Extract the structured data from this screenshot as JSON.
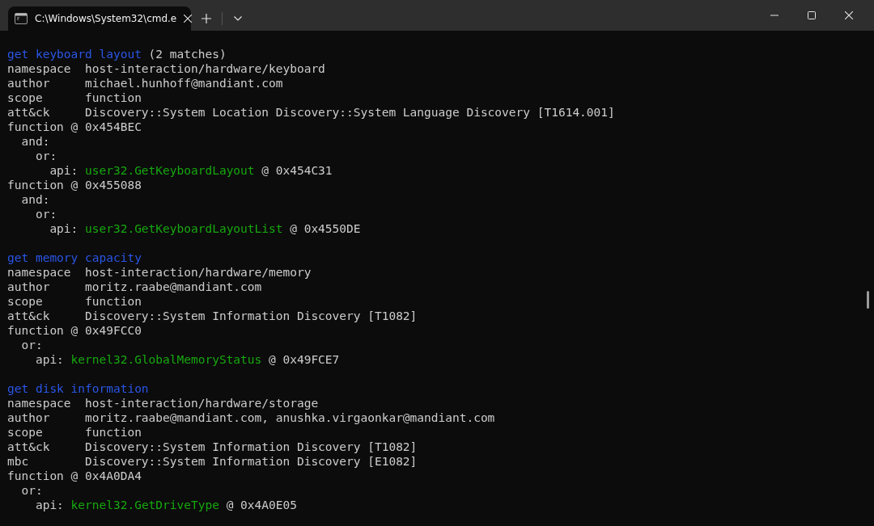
{
  "tabs": [
    {
      "title": "C:\\Windows\\System32\\cmd.e",
      "selected": true
    }
  ],
  "terminal": {
    "sections": [
      {
        "lines": [
          {
            "segments": [
              {
                "kind": "rule",
                "text": "get keyboard layout"
              },
              {
                "kind": "text",
                "text": " (2 matches)"
              }
            ]
          },
          {
            "segments": [
              {
                "kind": "text",
                "text": "namespace  host-interaction/hardware/keyboard"
              }
            ]
          },
          {
            "segments": [
              {
                "kind": "text",
                "text": "author     michael.hunhoff@mandiant.com"
              }
            ]
          },
          {
            "segments": [
              {
                "kind": "text",
                "text": "scope      function"
              }
            ]
          },
          {
            "segments": [
              {
                "kind": "text",
                "text": "att&ck     Discovery::System Location Discovery::System Language Discovery [T1614.001]"
              }
            ]
          },
          {
            "segments": [
              {
                "kind": "text",
                "text": "function @ 0x454BEC"
              }
            ]
          },
          {
            "segments": [
              {
                "kind": "text",
                "text": "  and:"
              }
            ]
          },
          {
            "segments": [
              {
                "kind": "text",
                "text": "    or:"
              }
            ]
          },
          {
            "segments": [
              {
                "kind": "text",
                "text": "      api: "
              },
              {
                "kind": "api",
                "text": "user32.GetKeyboardLayout"
              },
              {
                "kind": "text",
                "text": " @ 0x454C31"
              }
            ]
          },
          {
            "segments": [
              {
                "kind": "text",
                "text": "function @ 0x455088"
              }
            ]
          },
          {
            "segments": [
              {
                "kind": "text",
                "text": "  and:"
              }
            ]
          },
          {
            "segments": [
              {
                "kind": "text",
                "text": "    or:"
              }
            ]
          },
          {
            "segments": [
              {
                "kind": "text",
                "text": "      api: "
              },
              {
                "kind": "api",
                "text": "user32.GetKeyboardLayoutList"
              },
              {
                "kind": "text",
                "text": " @ 0x4550DE"
              }
            ]
          }
        ]
      },
      {
        "lines": [
          {
            "segments": [
              {
                "kind": "rule",
                "text": "get memory capacity"
              }
            ]
          },
          {
            "segments": [
              {
                "kind": "text",
                "text": "namespace  host-interaction/hardware/memory"
              }
            ]
          },
          {
            "segments": [
              {
                "kind": "text",
                "text": "author     moritz.raabe@mandiant.com"
              }
            ]
          },
          {
            "segments": [
              {
                "kind": "text",
                "text": "scope      function"
              }
            ]
          },
          {
            "segments": [
              {
                "kind": "text",
                "text": "att&ck     Discovery::System Information Discovery [T1082]"
              }
            ]
          },
          {
            "segments": [
              {
                "kind": "text",
                "text": "function @ 0x49FCC0"
              }
            ]
          },
          {
            "segments": [
              {
                "kind": "text",
                "text": "  or:"
              }
            ]
          },
          {
            "segments": [
              {
                "kind": "text",
                "text": "    api: "
              },
              {
                "kind": "api",
                "text": "kernel32.GlobalMemoryStatus"
              },
              {
                "kind": "text",
                "text": " @ 0x49FCE7"
              }
            ]
          }
        ]
      },
      {
        "lines": [
          {
            "segments": [
              {
                "kind": "rule",
                "text": "get disk information"
              }
            ]
          },
          {
            "segments": [
              {
                "kind": "text",
                "text": "namespace  host-interaction/hardware/storage"
              }
            ]
          },
          {
            "segments": [
              {
                "kind": "text",
                "text": "author     moritz.raabe@mandiant.com, anushka.virgaonkar@mandiant.com"
              }
            ]
          },
          {
            "segments": [
              {
                "kind": "text",
                "text": "scope      function"
              }
            ]
          },
          {
            "segments": [
              {
                "kind": "text",
                "text": "att&ck     Discovery::System Information Discovery [T1082]"
              }
            ]
          },
          {
            "segments": [
              {
                "kind": "text",
                "text": "mbc        Discovery::System Information Discovery [E1082]"
              }
            ]
          },
          {
            "segments": [
              {
                "kind": "text",
                "text": "function @ 0x4A0DA4"
              }
            ]
          },
          {
            "segments": [
              {
                "kind": "text",
                "text": "  or:"
              }
            ]
          },
          {
            "segments": [
              {
                "kind": "text",
                "text": "    api: "
              },
              {
                "kind": "api",
                "text": "kernel32.GetDriveType"
              },
              {
                "kind": "text",
                "text": " @ 0x4A0E05"
              }
            ]
          }
        ]
      }
    ]
  }
}
